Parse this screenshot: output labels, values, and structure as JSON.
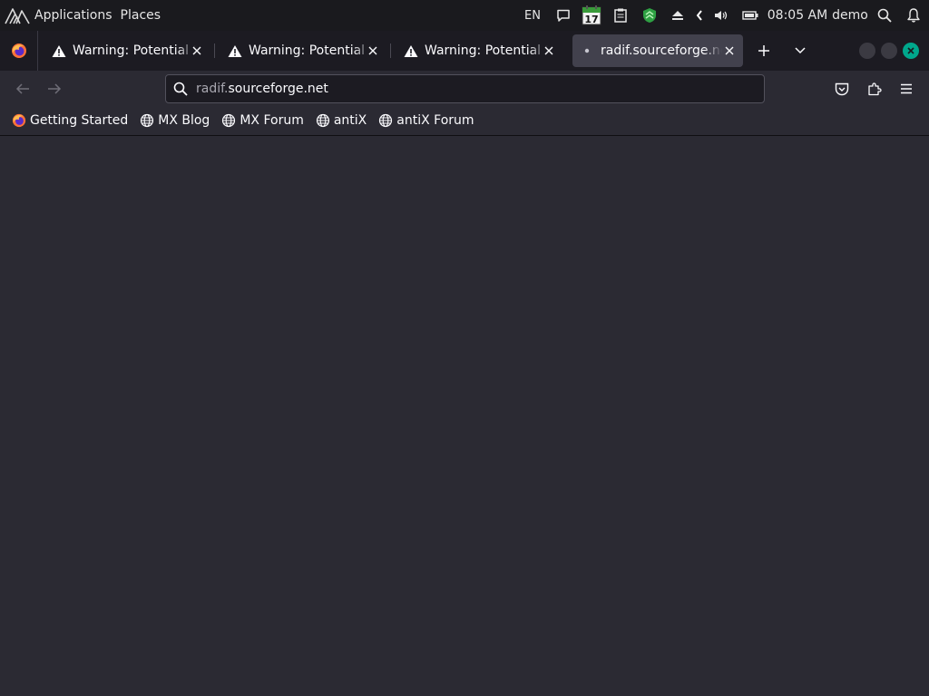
{
  "panel": {
    "menu": [
      "Applications",
      "Places"
    ],
    "keyboard_layout": "EN",
    "calendar_day": "17",
    "time": "08:05 AM",
    "user": "demo",
    "icons": [
      "mx-logo-icon",
      "chat-icon",
      "calendar-icon",
      "clipboard-icon",
      "shield-update-icon",
      "eject-icon",
      "collapse-tray-icon",
      "volume-icon",
      "battery-icon",
      "search-icon",
      "notifications-bell-icon"
    ]
  },
  "tabs": [
    {
      "title": "Warning: Potential Security Risk Ahead",
      "icon": "warning-icon",
      "active": false
    },
    {
      "title": "Warning: Potential Security Risk Ahead",
      "icon": "warning-icon",
      "active": false
    },
    {
      "title": "Warning: Potential Security Risk Ahead",
      "icon": "warning-icon",
      "active": false
    },
    {
      "title": "radif.sourceforge.net",
      "icon": "loading-dot-icon",
      "active": true
    }
  ],
  "urlbar": {
    "subdomain": "radif.",
    "domain": "sourceforge.net"
  },
  "bookmarks": [
    {
      "label": "Getting Started",
      "icon": "firefox-icon"
    },
    {
      "label": "MX Blog",
      "icon": "globe-icon"
    },
    {
      "label": "MX Forum",
      "icon": "globe-icon"
    },
    {
      "label": "antiX",
      "icon": "globe-icon"
    },
    {
      "label": "antiX Forum",
      "icon": "globe-icon"
    }
  ],
  "colors": {
    "panel_bg": "#1a1a1e",
    "tabstrip_bg": "#1c1b22",
    "toolbar_bg": "#2b2a33",
    "active_tab_bg": "#42414d",
    "close_button": "#00a78c"
  }
}
